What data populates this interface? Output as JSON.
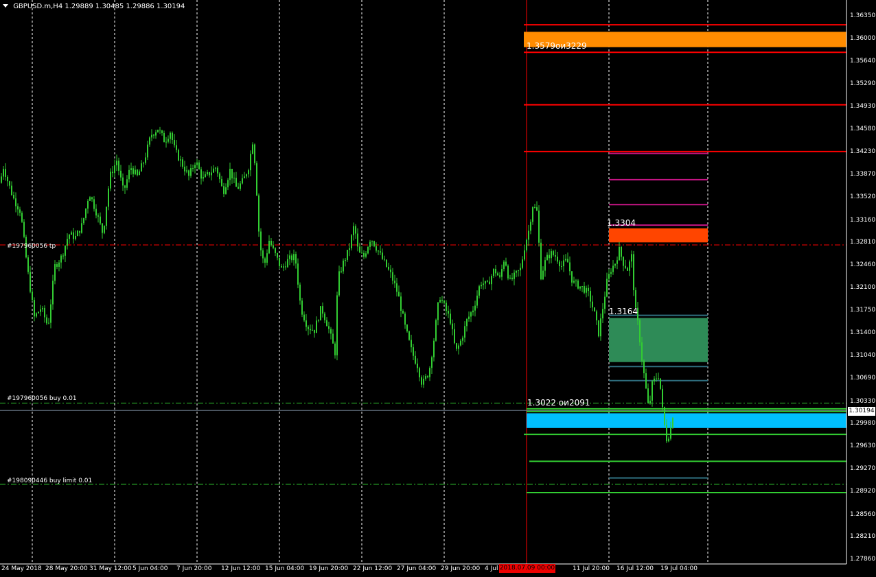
{
  "header": {
    "symbol": "GBPUSD.m,H4",
    "ohlc": "1.29889 1.30485 1.29886 1.30194"
  },
  "order_labels": {
    "tp": "#197960056 tp",
    "buy": "#197960056 buy 0.01",
    "buy_limit": "#198090446 buy limit 0.01"
  },
  "zone_labels": {
    "top_orange": "1.3579ои3229",
    "red_zone": "1.3304",
    "green_zone": "1.3164",
    "blue_zone": "1.3022 ои2091"
  },
  "price_axis": [
    "1.36350",
    "1.36000",
    "1.35640",
    "1.35290",
    "1.34930",
    "1.34580",
    "1.34230",
    "1.33870",
    "1.33520",
    "1.33160",
    "1.32810",
    "1.32460",
    "1.32100",
    "1.31750",
    "1.31400",
    "1.31040",
    "1.30690",
    "1.30330",
    "1.29980",
    "1.29630",
    "1.29270",
    "1.28920",
    "1.28560",
    "1.28210",
    "1.27860"
  ],
  "current_price": "1.30194",
  "time_axis": [
    "24 May 2018",
    "28 May 20:00",
    "31 May 12:00",
    "5 Jun 04:00",
    "7 Jun 20:00",
    "12 Jun 12:00",
    "15 Jun 04:00",
    "19 Jun 20:00",
    "22 Jun 12:00",
    "27 Jun 04:00",
    "29 Jun 20:00",
    "4 Jul",
    "11 Jul 20:00",
    "16 Jul 12:00",
    "19 Jul 04:00"
  ],
  "date_marker": "2018.07.09 00:00",
  "colors": {
    "background": "#000000",
    "candle": "#32cd32",
    "grid": "#ffffff",
    "orange_zone": "#ff8c00",
    "red_zone": "#ff4500",
    "green_zone": "#2e8b57",
    "blue_zone": "#00bfff",
    "red_line": "#ff0000",
    "magenta_line": "#c71585",
    "teal_line": "#2f6f7f",
    "green_line": "#32cd32"
  },
  "chart_data": {
    "type": "candlestick",
    "symbol": "GBPUSD.m",
    "timeframe": "H4",
    "ylim": [
      1.2786,
      1.3635
    ],
    "close_path": [
      [
        0,
        1.3375
      ],
      [
        5,
        1.34
      ],
      [
        12,
        1.3375
      ],
      [
        20,
        1.335
      ],
      [
        30,
        1.333
      ],
      [
        40,
        1.324
      ],
      [
        50,
        1.3165
      ],
      [
        60,
        1.318
      ],
      [
        70,
        1.315
      ],
      [
        80,
        1.3245
      ],
      [
        90,
        1.326
      ],
      [
        100,
        1.3295
      ],
      [
        110,
        1.329
      ],
      [
        120,
        1.331
      ],
      [
        130,
        1.336
      ],
      [
        140,
        1.333
      ],
      [
        150,
        1.3295
      ],
      [
        160,
        1.3385
      ],
      [
        170,
        1.341
      ],
      [
        180,
        1.336
      ],
      [
        190,
        1.34
      ],
      [
        200,
        1.3385
      ],
      [
        210,
        1.341
      ],
      [
        220,
        1.345
      ],
      [
        230,
        1.346
      ],
      [
        240,
        1.344
      ],
      [
        248,
        1.3455
      ],
      [
        255,
        1.3425
      ],
      [
        265,
        1.3405
      ],
      [
        275,
        1.3385
      ],
      [
        285,
        1.341
      ],
      [
        295,
        1.338
      ],
      [
        305,
        1.339
      ],
      [
        315,
        1.34
      ],
      [
        325,
        1.336
      ],
      [
        335,
        1.3395
      ],
      [
        345,
        1.3365
      ],
      [
        355,
        1.338
      ],
      [
        362,
        1.34
      ],
      [
        368,
        1.344
      ],
      [
        372,
        1.34
      ],
      [
        378,
        1.328
      ],
      [
        385,
        1.3245
      ],
      [
        392,
        1.3285
      ],
      [
        400,
        1.3265
      ],
      [
        410,
        1.324
      ],
      [
        420,
        1.3255
      ],
      [
        430,
        1.326
      ],
      [
        438,
        1.318
      ],
      [
        448,
        1.315
      ],
      [
        458,
        1.3145
      ],
      [
        468,
        1.318
      ],
      [
        478,
        1.315
      ],
      [
        488,
        1.311
      ],
      [
        492,
        1.3225
      ],
      [
        500,
        1.325
      ],
      [
        508,
        1.327
      ],
      [
        516,
        1.331
      ],
      [
        522,
        1.3265
      ],
      [
        530,
        1.326
      ],
      [
        540,
        1.329
      ],
      [
        550,
        1.327
      ],
      [
        560,
        1.325
      ],
      [
        570,
        1.323
      ],
      [
        580,
        1.32
      ],
      [
        590,
        1.315
      ],
      [
        600,
        1.311
      ],
      [
        608,
        1.309
      ],
      [
        615,
        1.306
      ],
      [
        625,
        1.308
      ],
      [
        632,
        1.313
      ],
      [
        640,
        1.32
      ],
      [
        648,
        1.318
      ],
      [
        656,
        1.316
      ],
      [
        664,
        1.311
      ],
      [
        672,
        1.313
      ],
      [
        680,
        1.316
      ],
      [
        690,
        1.318
      ],
      [
        700,
        1.322
      ],
      [
        710,
        1.3215
      ],
      [
        720,
        1.324
      ],
      [
        728,
        1.3225
      ],
      [
        735,
        1.326
      ],
      [
        742,
        1.322
      ],
      [
        750,
        1.323
      ],
      [
        758,
        1.324
      ],
      [
        765,
        1.328
      ],
      [
        770,
        1.33
      ],
      [
        776,
        1.334
      ],
      [
        782,
        1.333
      ],
      [
        788,
        1.323
      ],
      [
        795,
        1.3255
      ],
      [
        802,
        1.3265
      ],
      [
        810,
        1.326
      ],
      [
        818,
        1.3245
      ],
      [
        826,
        1.3255
      ],
      [
        834,
        1.322
      ],
      [
        842,
        1.3215
      ],
      [
        850,
        1.321
      ],
      [
        858,
        1.32
      ],
      [
        866,
        1.317
      ],
      [
        872,
        1.314
      ],
      [
        878,
        1.318
      ],
      [
        884,
        1.322
      ],
      [
        890,
        1.324
      ],
      [
        896,
        1.325
      ],
      [
        902,
        1.327
      ],
      [
        908,
        1.325
      ],
      [
        914,
        1.324
      ],
      [
        920,
        1.326
      ],
      [
        925,
        1.318
      ],
      [
        930,
        1.315
      ],
      [
        935,
        1.31
      ],
      [
        940,
        1.306
      ],
      [
        945,
        1.302
      ],
      [
        950,
        1.306
      ],
      [
        955,
        1.307
      ],
      [
        960,
        1.3075
      ],
      [
        966,
        1.301
      ],
      [
        971,
        1.2975
      ],
      [
        976,
        1.2985
      ],
      [
        981,
        1.3019
      ]
    ]
  }
}
